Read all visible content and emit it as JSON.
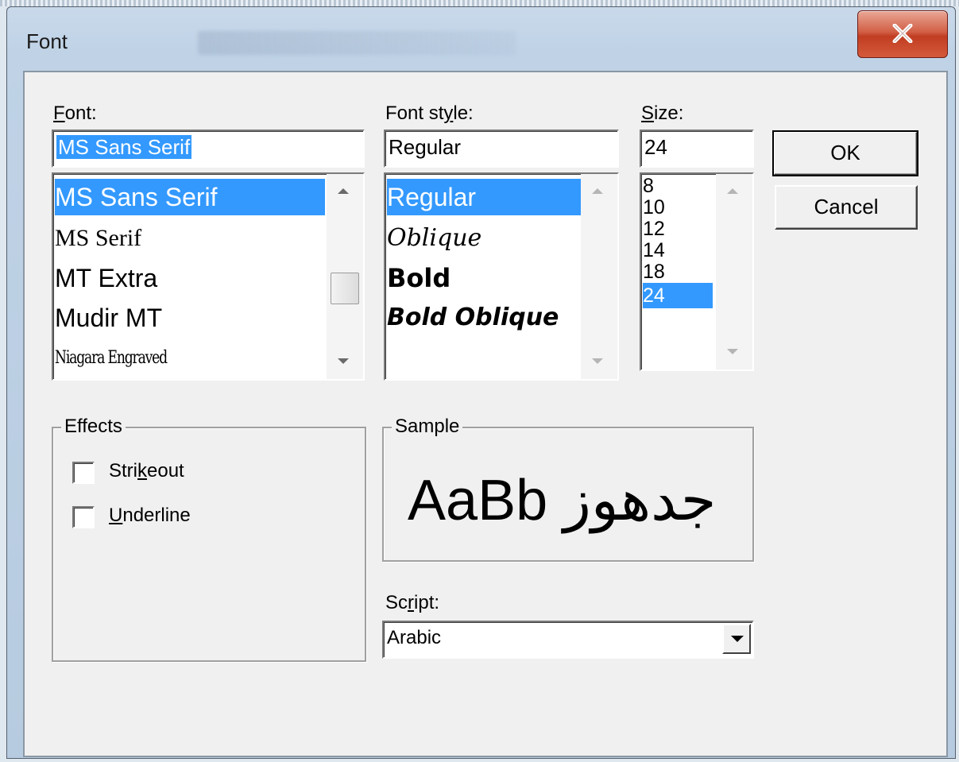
{
  "window": {
    "title": "Font",
    "close_glyph": "X"
  },
  "font": {
    "label_accel": "F",
    "label_rest": "ont:",
    "value": "MS Sans Serif",
    "items": [
      {
        "label": "MS Sans Serif"
      },
      {
        "label": "MS Serif"
      },
      {
        "label": "MT Extra"
      },
      {
        "label": "Mudir MT"
      },
      {
        "label": "Niagara Engraved"
      }
    ]
  },
  "style": {
    "label_pre": "Font st",
    "label_accel": "y",
    "label_post": "le:",
    "value": "Regular",
    "items": [
      {
        "label": "Regular"
      },
      {
        "label": "Oblique"
      },
      {
        "label": "Bold"
      },
      {
        "label": "Bold Oblique"
      }
    ]
  },
  "size": {
    "label_accel": "S",
    "label_rest": "ize:",
    "value": "24",
    "items": [
      "8",
      "10",
      "12",
      "14",
      "18",
      "24"
    ]
  },
  "buttons": {
    "ok": "OK",
    "cancel": "Cancel"
  },
  "effects": {
    "title": "Effects",
    "strikeout_pre": "Stri",
    "strikeout_accel": "k",
    "strikeout_post": "eout",
    "underline_accel": "U",
    "underline_rest": "nderline",
    "strikeout_checked": false,
    "underline_checked": false
  },
  "sample": {
    "title": "Sample",
    "text": "AaBb جدهوز"
  },
  "script": {
    "label_pre": "Sc",
    "label_accel": "r",
    "label_post": "ipt:",
    "value": "Arabic"
  },
  "colors": {
    "selection": "#3399ff",
    "face": "#f0f0f0",
    "close": "#c13d22"
  }
}
